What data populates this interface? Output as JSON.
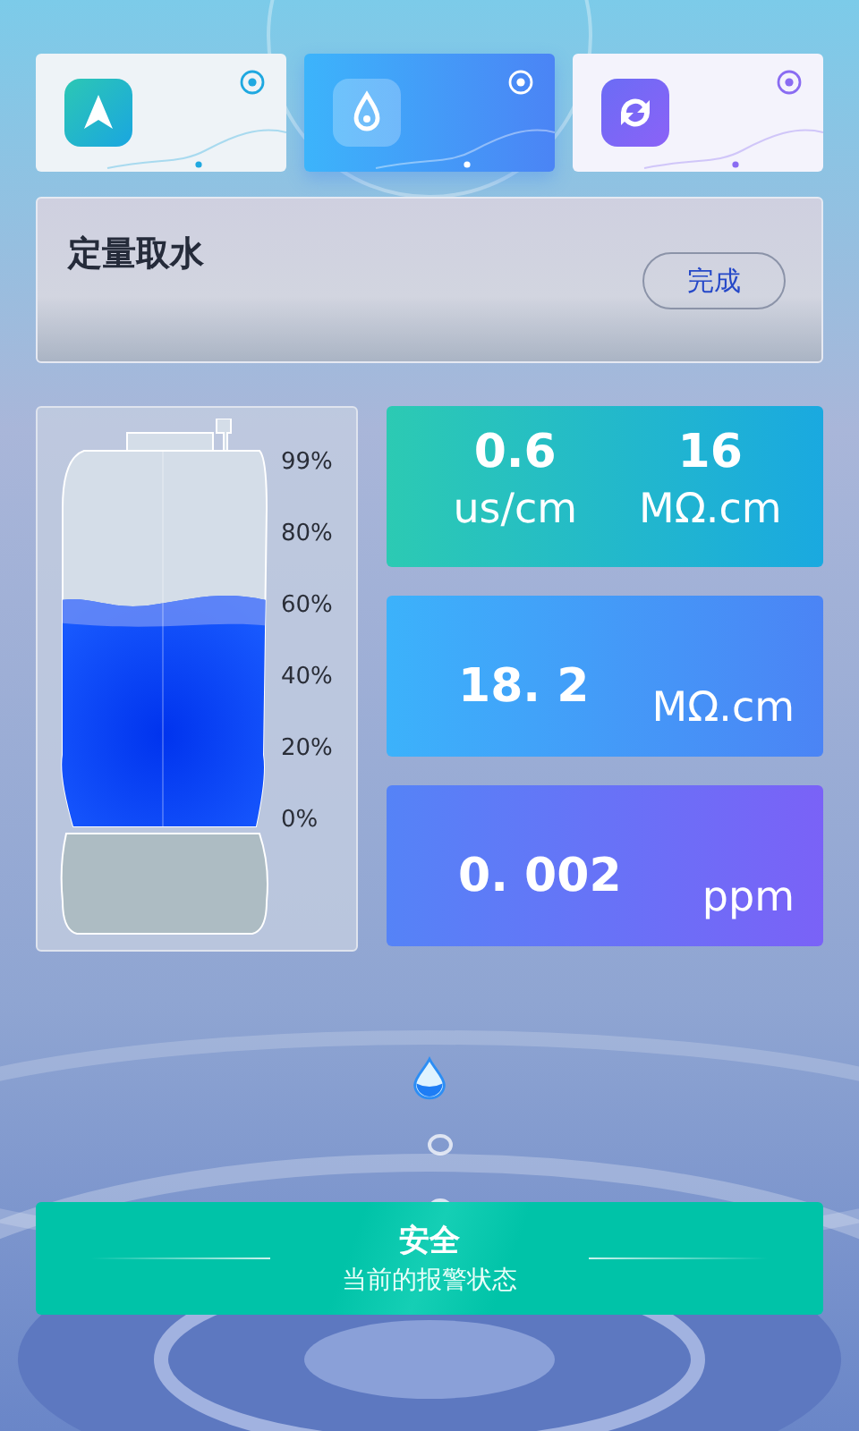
{
  "modes": [
    {
      "selected": false
    },
    {
      "selected": true
    },
    {
      "selected": false
    }
  ],
  "task": {
    "title": "定量取水",
    "button": "完成"
  },
  "tank": {
    "level": 0.6,
    "scale": [
      "99%",
      "80%",
      "60%",
      "40%",
      "20%",
      "0%"
    ]
  },
  "readings": [
    {
      "kind": "pair",
      "items": [
        {
          "value": "0.6",
          "unit": "us/cm"
        },
        {
          "value": "16",
          "unit": "MΩ.cm"
        }
      ]
    },
    {
      "kind": "single",
      "items": [
        {
          "value": "18. 2",
          "unit": "MΩ.cm"
        }
      ]
    },
    {
      "kind": "single",
      "items": [
        {
          "value": "0. 002",
          "unit": "ppm"
        }
      ]
    }
  ],
  "status": {
    "title": "安全",
    "subtitle": "当前的报警状态"
  }
}
